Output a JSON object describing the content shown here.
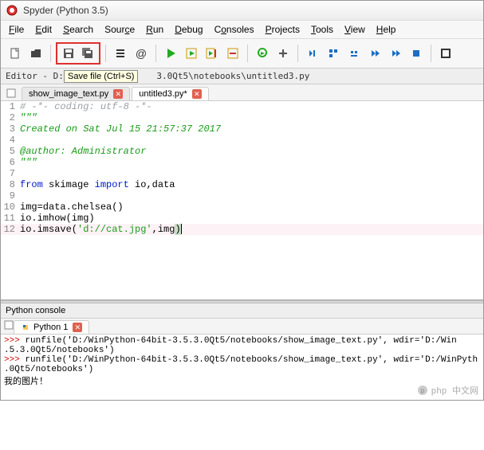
{
  "window": {
    "title": "Spyder (Python 3.5)"
  },
  "menubar": [
    "File",
    "Edit",
    "Search",
    "Source",
    "Run",
    "Debug",
    "Consoles",
    "Projects",
    "Tools",
    "View",
    "Help"
  ],
  "tooltip": "Save file (Ctrl+S)",
  "editor_path_label": "Editor - D:\\W",
  "editor_path_rest": "3.0Qt5\\notebooks\\untitled3.py",
  "tabs": [
    {
      "name": "show_image_text.py",
      "dirty": false,
      "active": false
    },
    {
      "name": "untitled3.py*",
      "dirty": true,
      "active": true
    }
  ],
  "code": {
    "lines": [
      {
        "n": 1,
        "seg": [
          {
            "t": "# -*- coding: utf-8 -*-",
            "c": "c-comment"
          }
        ]
      },
      {
        "n": 2,
        "seg": [
          {
            "t": "\"\"\"",
            "c": "c-docstr"
          }
        ]
      },
      {
        "n": 3,
        "seg": [
          {
            "t": "Created on Sat Jul 15 21:57:37 2017",
            "c": "c-docstr"
          }
        ]
      },
      {
        "n": 4,
        "seg": [
          {
            "t": "",
            "c": ""
          }
        ]
      },
      {
        "n": 5,
        "seg": [
          {
            "t": "@author: Administrator",
            "c": "c-docstr"
          }
        ]
      },
      {
        "n": 6,
        "seg": [
          {
            "t": "\"\"\"",
            "c": "c-docstr"
          }
        ]
      },
      {
        "n": 7,
        "seg": [
          {
            "t": "",
            "c": ""
          }
        ]
      },
      {
        "n": 8,
        "seg": [
          {
            "t": "from ",
            "c": "c-kw"
          },
          {
            "t": "skimage ",
            "c": ""
          },
          {
            "t": "import ",
            "c": "c-kw"
          },
          {
            "t": "io,data",
            "c": ""
          }
        ]
      },
      {
        "n": 9,
        "seg": [
          {
            "t": "",
            "c": ""
          }
        ]
      },
      {
        "n": 10,
        "seg": [
          {
            "t": "img=data.chelsea()",
            "c": ""
          }
        ]
      },
      {
        "n": 11,
        "seg": [
          {
            "t": "io.imhow(img)",
            "c": ""
          }
        ]
      },
      {
        "n": 12,
        "hl": true,
        "seg": [
          {
            "t": "io.imsave(",
            "c": ""
          },
          {
            "t": "'d://cat.jpg'",
            "c": "c-str"
          },
          {
            "t": ",img",
            "c": ""
          },
          {
            "t": ")",
            "c": "c-cursor-bg"
          }
        ],
        "cursor": true
      }
    ]
  },
  "console": {
    "header": "Python console",
    "tab": "Python 1",
    "lines": [
      ">>> runfile('D:/WinPython-64bit-3.5.3.0Qt5/notebooks/show_image_text.py', wdir='D:/Win",
      ".5.3.0Qt5/notebooks')",
      ">>> runfile('D:/WinPython-64bit-3.5.3.0Qt5/notebooks/show_image_text.py', wdir='D:/WinPyth",
      ".0Qt5/notebooks')",
      "我的图片！"
    ]
  },
  "watermark": "php 中文网"
}
